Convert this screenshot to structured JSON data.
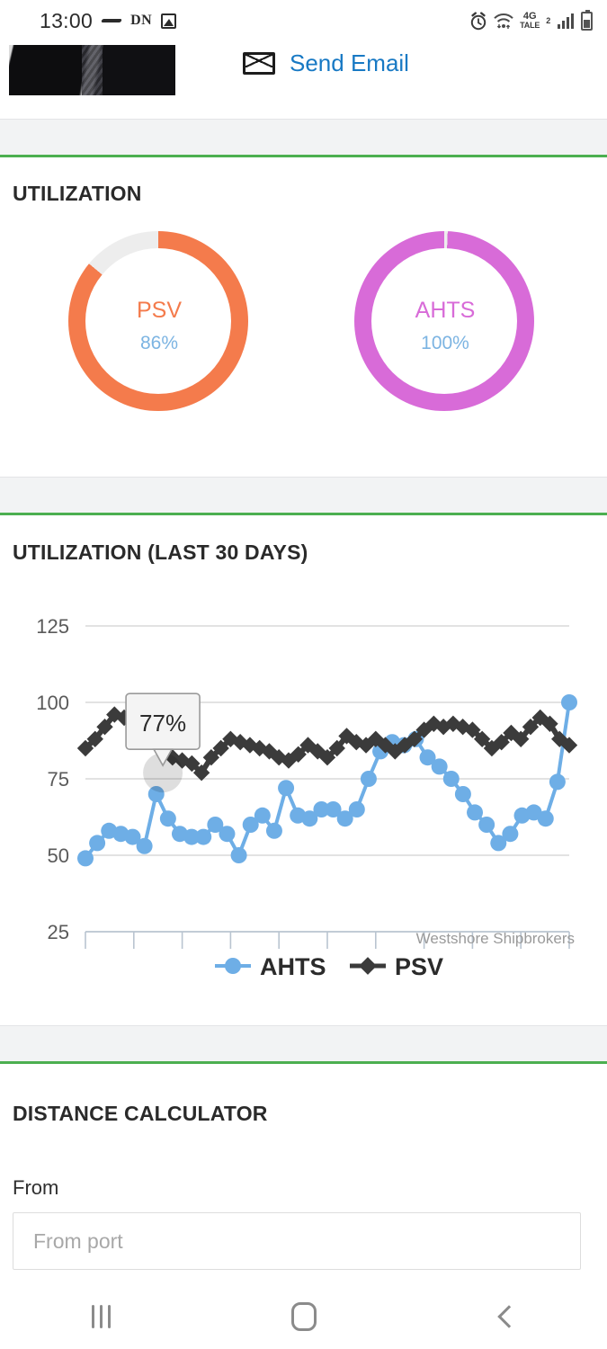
{
  "statusbar": {
    "time": "13:00",
    "carrier_label": "DN",
    "network_type": "4G",
    "network_name": "TALE",
    "sim_index": "2",
    "icons": [
      "alarm-icon",
      "wifi-icon",
      "signal-icon",
      "battery-icon",
      "photo-icon"
    ]
  },
  "header": {
    "send_email_label": "Send Email",
    "send_email_color": "#1879c4"
  },
  "utilization": {
    "title": "UTILIZATION",
    "gauges": [
      {
        "label": "PSV",
        "value": "86%",
        "percent": 86,
        "color": "#f47b4c",
        "track": "#ededed",
        "value_color": "#7cb4e2"
      },
      {
        "label": "AHTS",
        "value": "100%",
        "percent": 100,
        "color": "#d86bd8",
        "track": "#ededed",
        "value_color": "#7cb4e2"
      }
    ]
  },
  "chart_section": {
    "title": "UTILIZATION (LAST 30 DAYS)",
    "attribution": "Westshore Shipbrokers",
    "tooltip": "77%"
  },
  "chart_data": {
    "type": "line",
    "title": "UTILIZATION (LAST 30 DAYS)",
    "xlabel": "",
    "ylabel": "",
    "ylim": [
      25,
      125
    ],
    "yticks": [
      25,
      50,
      75,
      100,
      125
    ],
    "ytick_labels": [
      "25",
      "50",
      "75",
      "100",
      "125"
    ],
    "grid": true,
    "legend_position": "bottom",
    "x_tick_count": 10,
    "annotation": {
      "text": "77%",
      "series": "PSV",
      "index": 8,
      "value": 77
    },
    "x": [
      1,
      2,
      3,
      4,
      5,
      6,
      7,
      8,
      9,
      10,
      11,
      12,
      13,
      14,
      15,
      16,
      17,
      18,
      19,
      20,
      21,
      22,
      23,
      24,
      25,
      26,
      27,
      28,
      29,
      30,
      31,
      32,
      33,
      34,
      35,
      36,
      37,
      38,
      39,
      40,
      41,
      42,
      43,
      44,
      45,
      46,
      47,
      48
    ],
    "series": [
      {
        "name": "AHTS",
        "color": "#6eaee6",
        "marker": "circle",
        "values": [
          49,
          54,
          58,
          57,
          56,
          53,
          70,
          62,
          57,
          56,
          56,
          60,
          57,
          50,
          60,
          63,
          58,
          72,
          63,
          62,
          65,
          65,
          62,
          65,
          75,
          84,
          87,
          86,
          88,
          82,
          79,
          75,
          70,
          64,
          60,
          54,
          57,
          63,
          64,
          62,
          74,
          100
        ]
      },
      {
        "name": "PSV",
        "color": "#3b3b3b",
        "marker": "diamond",
        "values": [
          85,
          88,
          92,
          96,
          95,
          94,
          96,
          90,
          85,
          82,
          81,
          80,
          77,
          82,
          85,
          88,
          87,
          86,
          85,
          84,
          82,
          81,
          83,
          86,
          84,
          82,
          85,
          89,
          87,
          86,
          88,
          86,
          84,
          86,
          88,
          91,
          93,
          92,
          93,
          92,
          91,
          88,
          85,
          87,
          90,
          88,
          92,
          95,
          93,
          88,
          86
        ]
      }
    ],
    "legend": [
      {
        "label": "AHTS",
        "color": "#6eaee6",
        "marker": "circle"
      },
      {
        "label": "PSV",
        "color": "#3b3b3b",
        "marker": "diamond"
      }
    ]
  },
  "distance_calculator": {
    "title": "DISTANCE CALCULATOR",
    "from_label": "From",
    "from_value": "",
    "from_placeholder": "From port"
  },
  "navbar": {
    "recents_label": "recents-icon",
    "home_label": "home-icon",
    "back_label": "back-icon"
  },
  "theme": {
    "accent_green": "#4caf50",
    "band_gray": "#f2f3f4"
  }
}
